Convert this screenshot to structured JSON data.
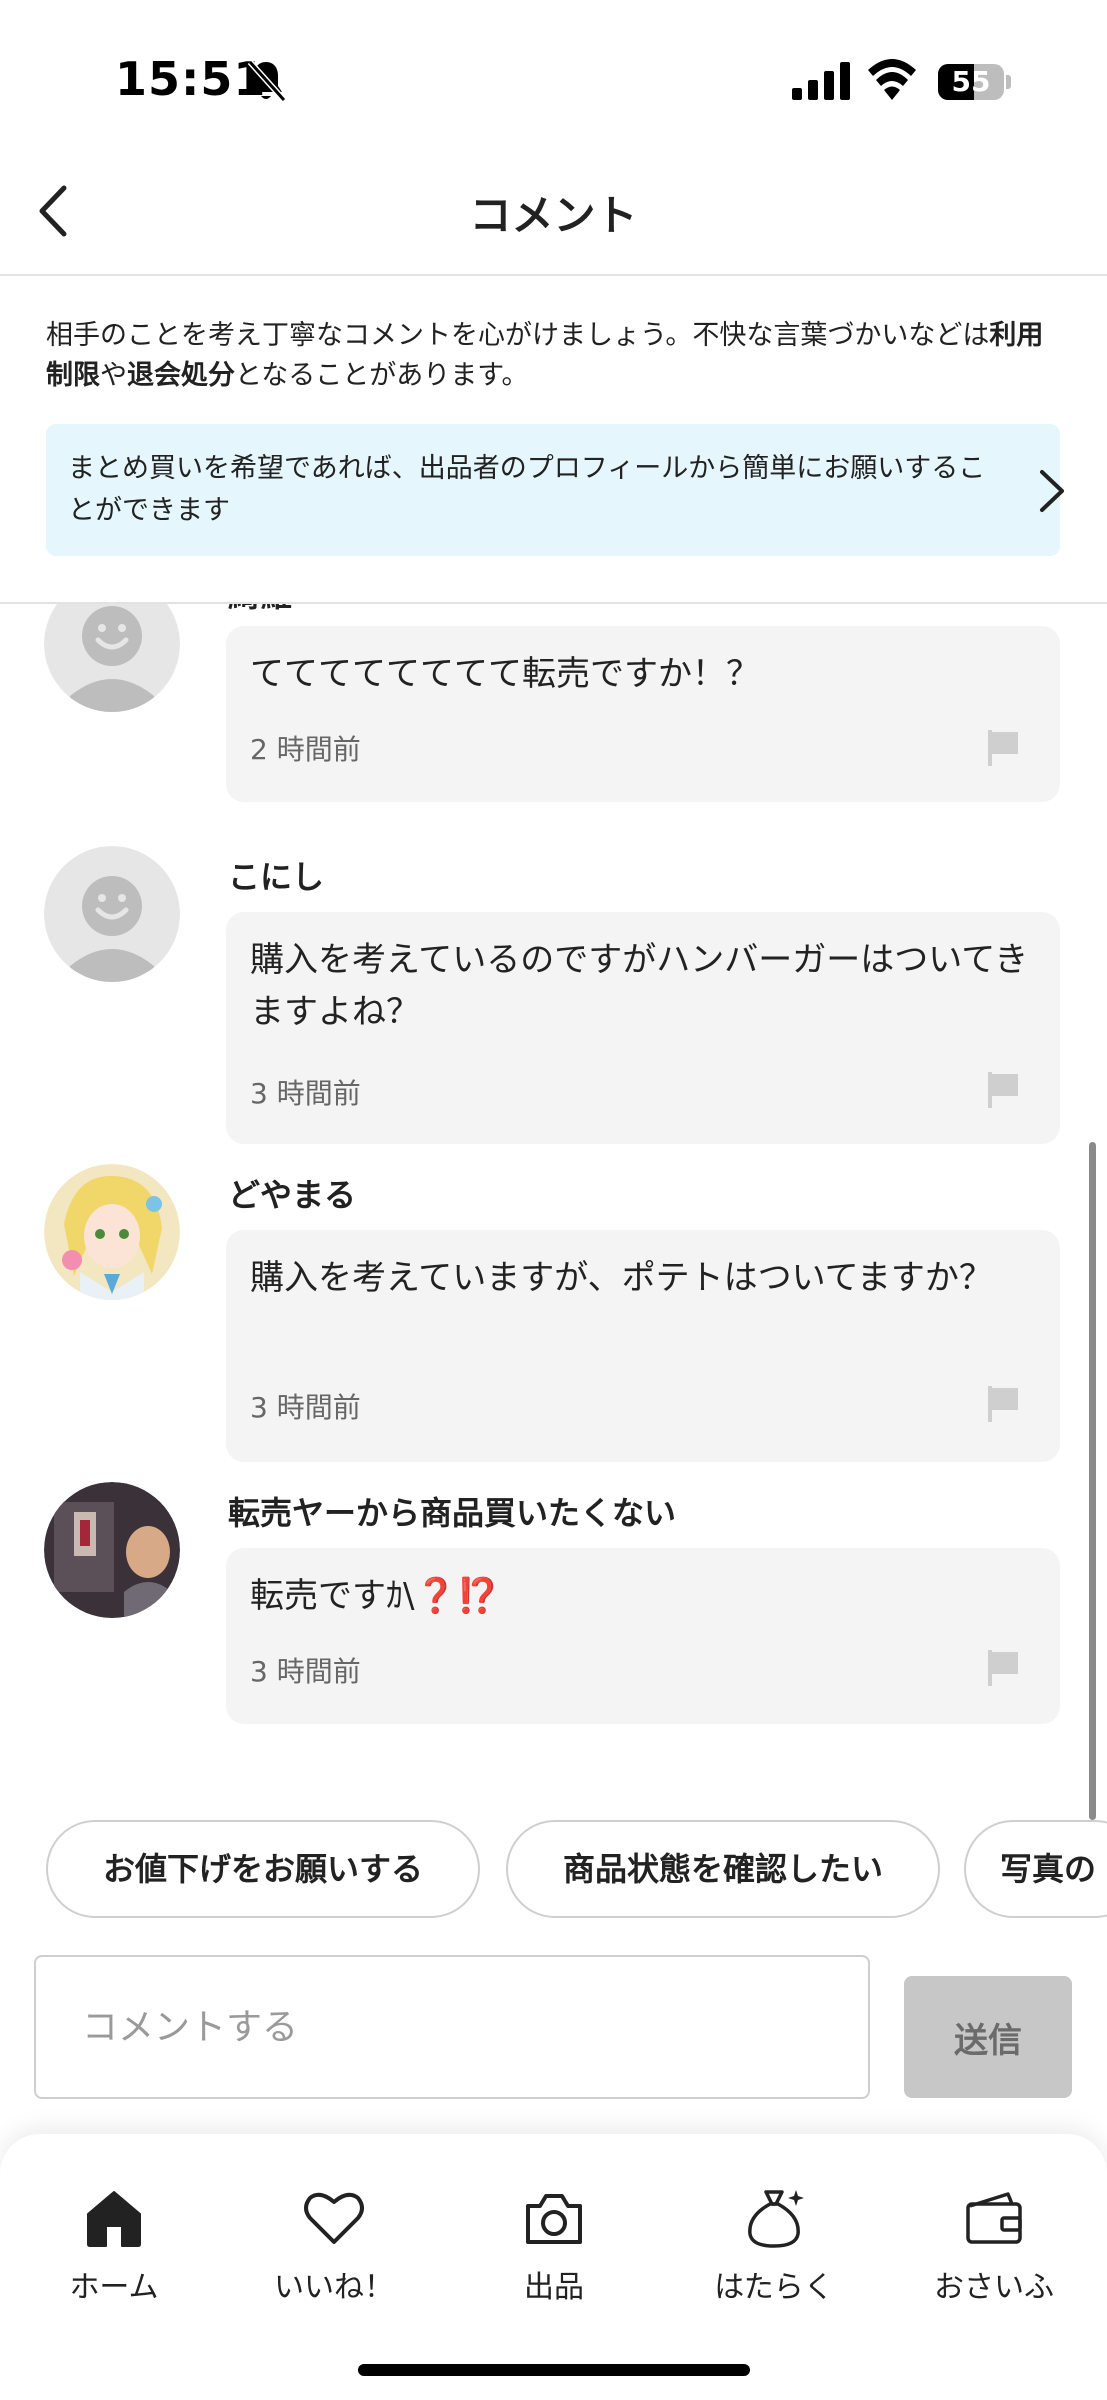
{
  "status_bar": {
    "time": "15:51",
    "battery_level": "55",
    "battery_fraction": 0.55,
    "icons": [
      "bell-slash-icon",
      "signal-icon",
      "wifi-icon",
      "battery-icon"
    ]
  },
  "header": {
    "title": "コメント",
    "back_icon": "chevron-left-icon"
  },
  "notice": {
    "text_1": "相手のことを考え丁寧なコメントを心がけましょう。不快な言葉づかいなどは",
    "bold_1": "利用制限",
    "text_2": "や",
    "bold_2": "退会処分",
    "text_3": "となることがあります。"
  },
  "bundle_banner": {
    "text": "まとめ買いを希望であれば、出品者のプロフィールから簡単にお願いすることができます",
    "icon": "chevron-right-icon"
  },
  "comments": [
    {
      "name": "綺羅",
      "text": "てててててててて転売ですか！？",
      "time": "2 時間前",
      "avatar": "default-avatar"
    },
    {
      "name": "こにし",
      "text": "購入を考えているのですがハンバーガーはついてきますよね？",
      "time": "3 時間前",
      "avatar": "default-avatar"
    },
    {
      "name": "どやまる",
      "text": "購入を考えていますが、ポテトはついてますか？",
      "time": "3 時間前",
      "avatar": "anime-girl-avatar"
    },
    {
      "name": "転売ヤーから商品買いたくない",
      "text": "転売ですｶ\\",
      "emoji_1": "❓",
      "emoji_2": "⁉️",
      "time": "3 時間前",
      "avatar": "photo-avatar"
    }
  ],
  "quick_replies": [
    "お値下げをお願いする",
    "商品状態を確認したい",
    "写真の"
  ],
  "input": {
    "placeholder": "コメントする",
    "value": "",
    "send_label": "送信"
  },
  "bottom_nav": [
    {
      "label": "ホーム",
      "icon": "home-icon",
      "active": true
    },
    {
      "label": "いいね！",
      "icon": "heart-icon",
      "active": false
    },
    {
      "label": "出品",
      "icon": "camera-icon",
      "active": false
    },
    {
      "label": "はたらく",
      "icon": "money-bag-icon",
      "active": false
    },
    {
      "label": "おさいふ",
      "icon": "wallet-icon",
      "active": false
    }
  ],
  "colors": {
    "banner_bg": "#e5f6fc",
    "bubble_bg": "#f4f4f4",
    "send_button_bg": "#c7c7c7",
    "emoji_red": "#e02020"
  }
}
